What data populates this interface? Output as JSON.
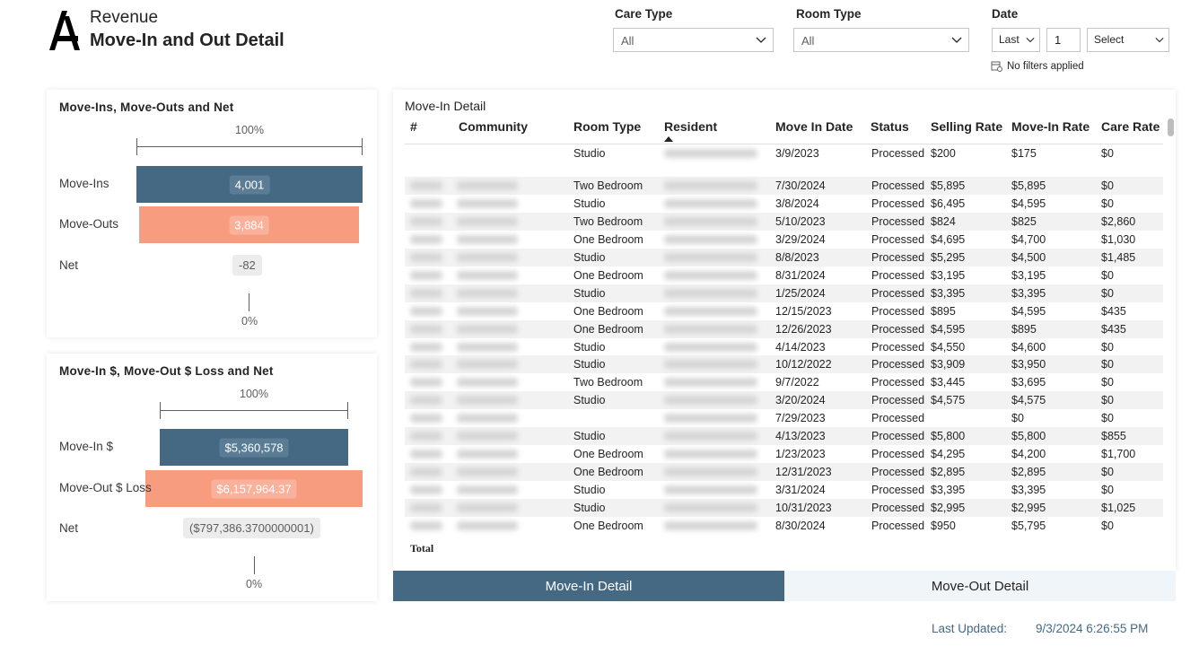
{
  "header": {
    "subtitle": "Revenue",
    "title": "Move-In and Out Detail"
  },
  "filters": {
    "care_type": {
      "label": "Care Type",
      "value": "All"
    },
    "room_type": {
      "label": "Room Type",
      "value": "All"
    },
    "date": {
      "label": "Date",
      "mode": "Last",
      "count": "1",
      "unit": "Select"
    },
    "status": "No filters applied"
  },
  "funnel1": {
    "title": "Move-Ins, Move-Outs and Net",
    "top_pct": "100%",
    "bottom_pct": "0%",
    "rows": [
      {
        "label": "Move-Ins",
        "value": "4,001"
      },
      {
        "label": "Move-Outs",
        "value": "3,884"
      },
      {
        "label": "Net",
        "value": "-82"
      }
    ]
  },
  "funnel2": {
    "title": "Move-In $, Move-Out $ Loss and Net",
    "top_pct": "100%",
    "bottom_pct": "0%",
    "rows": [
      {
        "label": "Move-In $",
        "value": "$5,360,578"
      },
      {
        "label": "Move-Out $ Loss",
        "value": "$6,157,964.37"
      },
      {
        "label": "Net",
        "value": "($797,386.3700000001)"
      }
    ]
  },
  "table": {
    "title": "Move-In Detail",
    "columns": [
      "#",
      "Community",
      "Room Type",
      "Resident",
      "Move In Date",
      "Status",
      "Selling Rate",
      "Move-In Rate",
      "Care Rate"
    ],
    "rows": [
      {
        "room": "Studio",
        "date": "3/9/2023",
        "status": "Processed",
        "selling": "$200",
        "movein": "$175",
        "care": "$0"
      },
      {
        "room": "Two Bedroom",
        "date": "7/30/2024",
        "status": "Processed",
        "selling": "$5,895",
        "movein": "$5,895",
        "care": "$0"
      },
      {
        "room": "Studio",
        "date": "3/8/2024",
        "status": "Processed",
        "selling": "$6,495",
        "movein": "$4,595",
        "care": "$0"
      },
      {
        "room": "Two Bedroom",
        "date": "5/10/2023",
        "status": "Processed",
        "selling": "$824",
        "movein": "$825",
        "care": "$2,860"
      },
      {
        "room": "One Bedroom",
        "date": "3/29/2024",
        "status": "Processed",
        "selling": "$4,695",
        "movein": "$4,700",
        "care": "$1,030"
      },
      {
        "room": "Studio",
        "date": "8/8/2023",
        "status": "Processed",
        "selling": "$5,295",
        "movein": "$4,500",
        "care": "$1,485"
      },
      {
        "room": "One Bedroom",
        "date": "8/31/2024",
        "status": "Processed",
        "selling": "$3,195",
        "movein": "$3,195",
        "care": "$0"
      },
      {
        "room": "Studio",
        "date": "1/25/2024",
        "status": "Processed",
        "selling": "$3,395",
        "movein": "$3,395",
        "care": "$0"
      },
      {
        "room": "One Bedroom",
        "date": "12/15/2023",
        "status": "Processed",
        "selling": "$895",
        "movein": "$4,595",
        "care": "$435"
      },
      {
        "room": "One Bedroom",
        "date": "12/26/2023",
        "status": "Processed",
        "selling": "$4,595",
        "movein": "$895",
        "care": "$435"
      },
      {
        "room": "Studio",
        "date": "4/14/2023",
        "status": "Processed",
        "selling": "$4,550",
        "movein": "$4,600",
        "care": "$0"
      },
      {
        "room": "Studio",
        "date": "10/12/2022",
        "status": "Processed",
        "selling": "$3,909",
        "movein": "$3,950",
        "care": "$0"
      },
      {
        "room": "Two Bedroom",
        "date": "9/7/2022",
        "status": "Processed",
        "selling": "$3,445",
        "movein": "$3,695",
        "care": "$0"
      },
      {
        "room": "Studio",
        "date": "3/20/2024",
        "status": "Processed",
        "selling": "$4,575",
        "movein": "$4,575",
        "care": "$0"
      },
      {
        "room": "",
        "date": "7/29/2023",
        "status": "Processed",
        "selling": "",
        "movein": "$0",
        "care": "$0"
      },
      {
        "room": "Studio",
        "date": "4/13/2023",
        "status": "Processed",
        "selling": "$5,800",
        "movein": "$5,800",
        "care": "$855"
      },
      {
        "room": "One Bedroom",
        "date": "1/23/2023",
        "status": "Processed",
        "selling": "$4,295",
        "movein": "$4,200",
        "care": "$1,700"
      },
      {
        "room": "One Bedroom",
        "date": "12/31/2023",
        "status": "Processed",
        "selling": "$2,895",
        "movein": "$2,895",
        "care": "$0"
      },
      {
        "room": "Studio",
        "date": "3/31/2024",
        "status": "Processed",
        "selling": "$3,395",
        "movein": "$3,395",
        "care": "$0"
      },
      {
        "room": "Studio",
        "date": "10/31/2023",
        "status": "Processed",
        "selling": "$2,995",
        "movein": "$2,995",
        "care": "$1,025"
      },
      {
        "room": "One Bedroom",
        "date": "8/30/2024",
        "status": "Processed",
        "selling": "$950",
        "movein": "$5,795",
        "care": "$0"
      }
    ],
    "total_label": "Total"
  },
  "tabs": {
    "active": "Move-In Detail",
    "inactive": "Move-Out Detail"
  },
  "footer": {
    "label": "Last Updated:",
    "value": "9/3/2024 6:26:55 PM"
  },
  "colors": {
    "blue": "#456983",
    "salmon": "#f89c80",
    "tab_inactive": "#eff5f8"
  }
}
